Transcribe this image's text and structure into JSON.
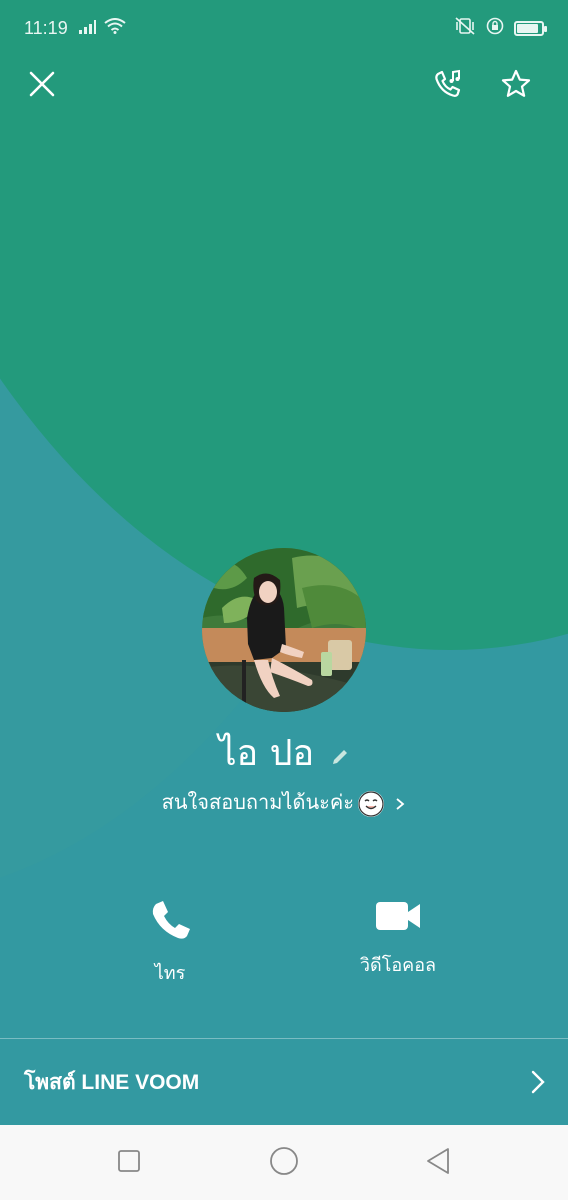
{
  "status_bar": {
    "time": "11:19"
  },
  "header": {
    "close_icon": "close-icon",
    "ringback_icon": "phone-music-icon",
    "favorite_icon": "star-icon"
  },
  "profile": {
    "name": "ไอ ปอ",
    "status_message": "สนใจสอบถามได้นะค่ะ",
    "emoji": "smiling-face-emoji"
  },
  "actions": {
    "call_label": "ไทร",
    "video_call_label": "วิดีโอคอล"
  },
  "voom": {
    "label": "โพสต์ LINE VOOM"
  },
  "colors": {
    "top_bg": "#239a7c",
    "bottom_bg": "#3399a1",
    "nav_bg": "#f8f8f8"
  }
}
